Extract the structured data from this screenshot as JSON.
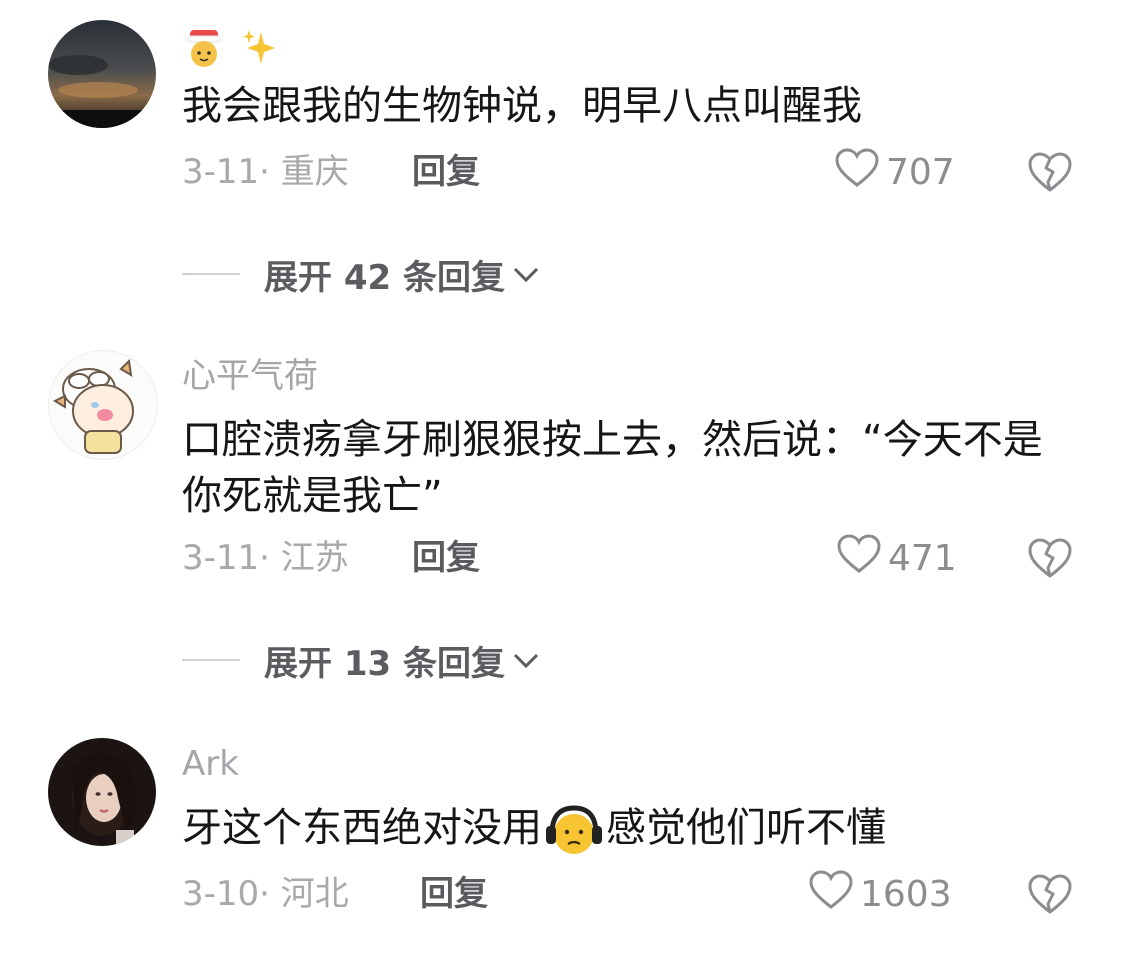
{
  "comments": [
    {
      "username": "",
      "emoji_name": [
        "baby-angel-emoji",
        "sparkles-emoji"
      ],
      "text": "我会跟我的生物钟说，明早八点叫醒我",
      "date_location": "3-11· 重庆",
      "reply_label": "回复",
      "likes": "707",
      "expand_label": "展开 42 条回复"
    },
    {
      "username": "心平气荷",
      "text": "口腔溃疡拿牙刷狠狠按上去，然后说：“今天不是你死就是我亡”",
      "date_location": "3-11· 江苏",
      "reply_label": "回复",
      "likes": "471",
      "expand_label": "展开 13 条回复"
    },
    {
      "username": "Ark",
      "text_before": "牙这个东西绝对没用",
      "inline_emoji": "headphone-face-emoji",
      "text_after": "感觉他们听不懂",
      "date_location": "3-10· 河北",
      "reply_label": "回复",
      "likes": "1603"
    }
  ],
  "colors": {
    "primary_text": "#161616",
    "secondary_text": "#a8a8ad",
    "action_text": "#5a5a5f",
    "icon": "#8c8c91"
  }
}
